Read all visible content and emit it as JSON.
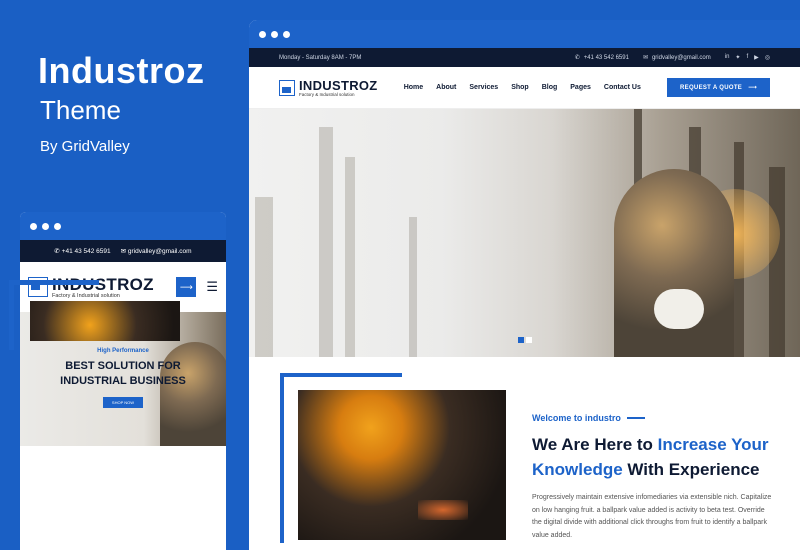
{
  "promo": {
    "title": "Industroz",
    "subtitle": "Theme",
    "by": "By GridValley"
  },
  "desktop": {
    "topbar": {
      "hours": "Monday - Saturday 8AM - 7PM",
      "phone": "+41 43 542 6591",
      "email": "gridvalley@gmail.com",
      "socials": [
        "in",
        "t",
        "f",
        "yt",
        "ig"
      ]
    },
    "logo": {
      "name": "INDUSTROZ",
      "tagline": "Factory & Industrial solution"
    },
    "menu": [
      "Home",
      "About",
      "Services",
      "Shop",
      "Blog",
      "Pages",
      "Contact Us"
    ],
    "cta": "REQUEST A QUOTE",
    "about": {
      "welcome": "Welcome to industro",
      "heading_a": "We Are Here to ",
      "heading_b": "Increase Your Knowledge",
      "heading_c": " With Experience",
      "paragraph": "Progressively maintain extensive infomediaries via extensible nich. Capitalize on low hanging fruit. a ballpark value added is activity to beta test. Override the digital divide with additional click throughs from fruit to identify a ballpark value added."
    }
  },
  "mobile": {
    "phone": "+41 43 542 6591",
    "email": "gridvalley@gmail.com",
    "logo": {
      "name": "INDUSTROZ",
      "tagline": "Factory & Industrial solution"
    },
    "hero": {
      "eyebrow": "High Performance",
      "line1": "BEST SOLUTION FOR",
      "line2": "INDUSTRIAL BUSINESS",
      "button": "SHOP NOW"
    }
  },
  "colors": {
    "brand": "#1d63c9",
    "dark": "#0e1a33",
    "background": "#1a5fc4"
  }
}
